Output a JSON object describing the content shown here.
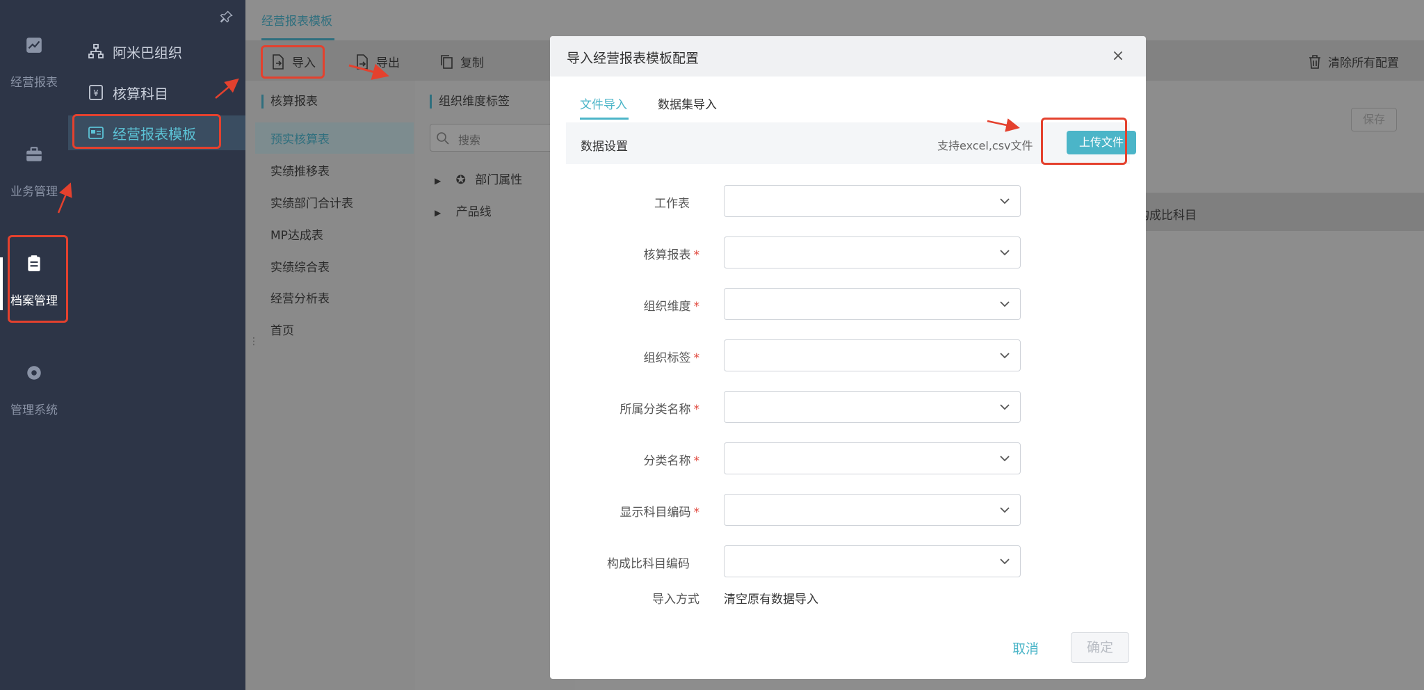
{
  "rail": {
    "items": [
      {
        "label": "经营报表",
        "icon": "line-chart-icon"
      },
      {
        "label": "业务管理",
        "icon": "briefcase-icon"
      },
      {
        "label": "档案管理",
        "icon": "clipboard-icon"
      },
      {
        "label": "管理系统",
        "icon": "gear-icon"
      }
    ]
  },
  "menu": {
    "items": [
      {
        "label": "阿米巴组织",
        "icon": "org-chart-icon"
      },
      {
        "label": "核算科目",
        "icon": "yen-doc-icon"
      },
      {
        "label": "经营报表模板",
        "icon": "template-icon"
      }
    ]
  },
  "tabs": {
    "active": "经营报表模板"
  },
  "toolbar": {
    "import": "导入",
    "export": "导出",
    "copy": "复制",
    "clear_all": "清除所有配置",
    "save": "保存"
  },
  "left_panel": {
    "title": "核算报表",
    "items": [
      "预实核算表",
      "实绩推移表",
      "实绩部门合计表",
      "MP达成表",
      "实绩综合表",
      "经营分析表",
      "首页"
    ]
  },
  "mid_panel": {
    "title": "组织维度标签",
    "search_placeholder": "搜索",
    "tree": [
      "部门属性",
      "产品线"
    ]
  },
  "right": {
    "row_text": "构成比科目"
  },
  "modal": {
    "title": "导入经营报表模板配置",
    "tabs": [
      "文件导入",
      "数据集导入"
    ],
    "data_settings": "数据设置",
    "upload_hint": "支持excel,csv文件",
    "upload_button": "上传文件",
    "fields": [
      {
        "label": "工作表",
        "required": false
      },
      {
        "label": "核算报表",
        "required": true
      },
      {
        "label": "组织维度",
        "required": true
      },
      {
        "label": "组织标签",
        "required": true
      },
      {
        "label": "所属分类名称",
        "required": true
      },
      {
        "label": "分类名称",
        "required": true
      },
      {
        "label": "显示科目编码",
        "required": true
      },
      {
        "label": "构成比科目编码",
        "required": false
      }
    ],
    "import_mode_label": "导入方式",
    "import_mode_value": "清空原有数据导入",
    "cancel": "取消",
    "ok": "确定"
  },
  "colors": {
    "accent": "#4bb5c8",
    "annotation": "#e4412e",
    "sidebar": "#2d3547"
  }
}
